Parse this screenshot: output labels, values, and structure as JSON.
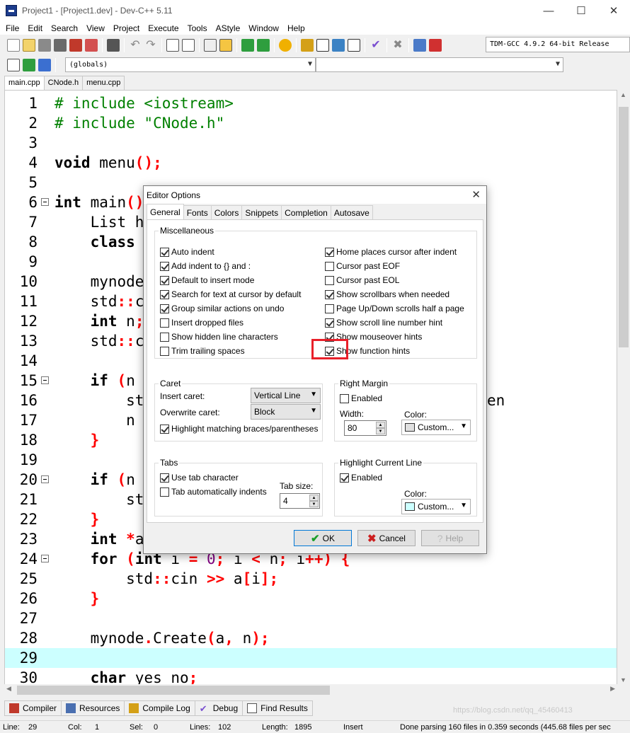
{
  "window": {
    "title": "Project1 - [Project1.dev] - Dev-C++ 5.11",
    "controls": {
      "minimize": "—",
      "maximize": "☐",
      "close": "✕"
    }
  },
  "menu": [
    "File",
    "Edit",
    "Search",
    "View",
    "Project",
    "Execute",
    "Tools",
    "AStyle",
    "Window",
    "Help"
  ],
  "toolbar": {
    "compiler_select": "TDM-GCC 4.9.2 64-bit Release",
    "scope_select": "(globals)",
    "member_select": ""
  },
  "file_tabs": [
    {
      "label": "main.cpp",
      "active": true
    },
    {
      "label": "CNode.h",
      "active": false
    },
    {
      "label": "menu.cpp",
      "active": false
    }
  ],
  "editor": {
    "lines": [
      {
        "n": "1",
        "html": "<span class='pp'># include &lt;iostream&gt;</span>"
      },
      {
        "n": "2",
        "html": "<span class='pp'># include \"CNode.h\"</span>"
      },
      {
        "n": "3",
        "html": ""
      },
      {
        "n": "4",
        "html": "<span class='kw'>void</span> menu<span class='op'>();</span>"
      },
      {
        "n": "5",
        "html": ""
      },
      {
        "n": "6",
        "html": "<span class='kw'>int</span> main<span class='op'>()</span>"
      },
      {
        "n": "7",
        "html": "    List h"
      },
      {
        "n": "8",
        "html": "    <span class='kw'>class</span>"
      },
      {
        "n": "9",
        "html": ""
      },
      {
        "n": "10",
        "html": "    mynode"
      },
      {
        "n": "11",
        "html": "    std<span class='op'>::</span>c                           dl<span class='op'>;</span>"
      },
      {
        "n": "12",
        "html": "    <span class='kw'>int</span> n<span class='op'>;</span>"
      },
      {
        "n": "13",
        "html": "    std<span class='op'>::</span>c"
      },
      {
        "n": "14",
        "html": ""
      },
      {
        "n": "15",
        "html": "    <span class='kw'>if</span> <span class='op'>(</span>n"
      },
      {
        "n": "16",
        "html": "        st                         <span class='str'>链表\"</span> <span class='op'>&lt;&lt;</span> std<span class='op'>::</span>en"
      },
      {
        "n": "17",
        "html": "        n"
      },
      {
        "n": "18",
        "html": "    <span class='op'>}</span>"
      },
      {
        "n": "19",
        "html": ""
      },
      {
        "n": "20",
        "html": "    <span class='kw'>if</span> <span class='op'>(</span>n"
      },
      {
        "n": "21",
        "html": "        st                         <span class='str'>列的整数: \"</span> <span class='op'>&lt;&lt;</span>"
      },
      {
        "n": "22",
        "html": "    <span class='op'>}</span>"
      },
      {
        "n": "23",
        "html": "    <span class='kw'>int</span> <span class='op'>*</span>a"
      },
      {
        "n": "24",
        "html": "    <span class='kw'>for</span> <span class='op'>(</span><span class='kw'>int</span> i <span class='op'>=</span> <span class='num'>0</span><span class='op'>;</span> i <span class='op'>&lt;</span> n<span class='op'>;</span> i<span class='op'>++)</span> <span class='op'>{</span>"
      },
      {
        "n": "25",
        "html": "        std<span class='op'>::</span>cin <span class='op'>&gt;&gt;</span> a<span class='op'>[</span>i<span class='op'>];</span>"
      },
      {
        "n": "26",
        "html": "    <span class='op'>}</span>"
      },
      {
        "n": "27",
        "html": ""
      },
      {
        "n": "28",
        "html": "    mynode<span class='op'>.</span>Create<span class='op'>(</span>a<span class='op'>,</span> n<span class='op'>);</span>"
      },
      {
        "n": "29",
        "html": "",
        "highlight": true
      },
      {
        "n": "30",
        "html": "    <span class='kw'>char</span> yes no<span class='op'>;</span>"
      }
    ]
  },
  "bottom_tabs": [
    "Compiler",
    "Resources",
    "Compile Log",
    "Debug",
    "Find Results"
  ],
  "status": {
    "line": "Line:",
    "line_val": "29",
    "col": "Col:",
    "col_val": "1",
    "sel": "Sel:",
    "sel_val": "0",
    "lines": "Lines:",
    "lines_val": "102",
    "length": "Length:",
    "length_val": "1895",
    "mode": "Insert",
    "message": "Done parsing 160 files in 0.359 seconds (445.68 files per sec"
  },
  "dialog": {
    "title": "Editor Options",
    "tabs": [
      "General",
      "Fonts",
      "Colors",
      "Snippets",
      "Completion",
      "Autosave"
    ],
    "misc_title": "Miscellaneous",
    "misc_left": [
      {
        "label": "Auto indent",
        "checked": true
      },
      {
        "label": "Add indent to {} and :",
        "checked": true
      },
      {
        "label": "Default to insert mode",
        "checked": true
      },
      {
        "label": "Search for text at cursor by default",
        "checked": true
      },
      {
        "label": "Group similar actions on undo",
        "checked": true
      },
      {
        "label": "Insert dropped files",
        "checked": false
      },
      {
        "label": "Show hidden line characters",
        "checked": false
      },
      {
        "label": "Trim trailing spaces",
        "checked": false
      }
    ],
    "misc_right": [
      {
        "label": "Home places cursor after indent",
        "checked": true
      },
      {
        "label": "Cursor past EOF",
        "checked": false
      },
      {
        "label": "Cursor past EOL",
        "checked": false
      },
      {
        "label": "Show scrollbars when needed",
        "checked": true
      },
      {
        "label": "Page Up/Down scrolls half a page",
        "checked": false
      },
      {
        "label": "Show scroll line number hint",
        "checked": true
      },
      {
        "label": "Show mouseover hints",
        "checked": true
      },
      {
        "label": "Show function hints",
        "checked": true
      }
    ],
    "caret": {
      "title": "Caret",
      "insert_label": "Insert caret:",
      "insert_value": "Vertical Line",
      "overwrite_label": "Overwrite caret:",
      "overwrite_value": "Block",
      "braces_label": "Highlight matching braces/parentheses",
      "braces_checked": true
    },
    "right_margin": {
      "title": "Right Margin",
      "enabled_label": "Enabled",
      "enabled_checked": false,
      "width_label": "Width:",
      "width_value": "80",
      "color_label": "Color:",
      "color_value": "Custom...",
      "color_swatch": "#e0e0e0"
    },
    "tabs_group": {
      "title": "Tabs",
      "use_tab_label": "Use tab character",
      "use_tab_checked": true,
      "auto_indent_label": "Tab automatically indents",
      "auto_indent_checked": false,
      "size_label": "Tab size:",
      "size_value": "4"
    },
    "highlight_line": {
      "title": "Highlight Current Line",
      "enabled_label": "Enabled",
      "enabled_checked": true,
      "color_label": "Color:",
      "color_value": "Custom...",
      "color_swatch": "#ccffff"
    },
    "buttons": {
      "ok": "OK",
      "cancel": "Cancel",
      "help": "Help"
    }
  },
  "watermark": "https://blog.csdn.net/qq_45460413"
}
